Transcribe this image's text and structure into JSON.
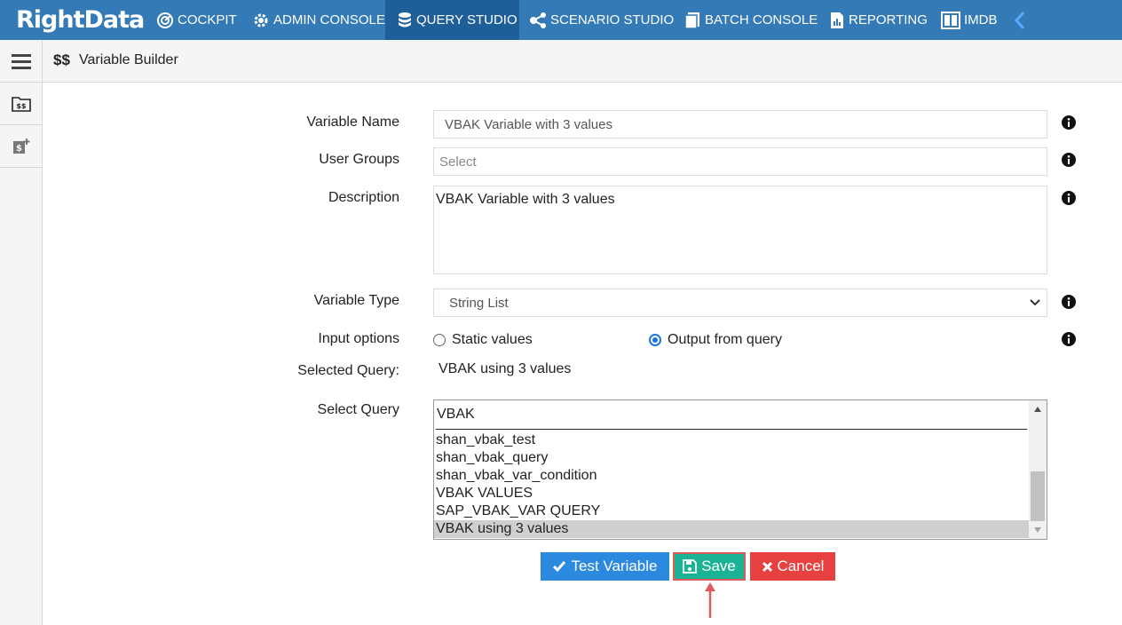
{
  "app": {
    "logo": "RightData"
  },
  "nav": [
    {
      "label": "COCKPIT",
      "icon": "cockpit-icon"
    },
    {
      "label": "ADMIN CONSOLE",
      "icon": "gear-icon"
    },
    {
      "label": "QUERY STUDIO",
      "icon": "database-icon",
      "active": true
    },
    {
      "label": "SCENARIO STUDIO",
      "icon": "network-icon"
    },
    {
      "label": "BATCH CONSOLE",
      "icon": "batch-icon"
    },
    {
      "label": "REPORTING",
      "icon": "report-icon"
    },
    {
      "label": "IMDB",
      "icon": "columns-icon"
    }
  ],
  "header": {
    "icon_text": "$$",
    "title": "Variable Builder"
  },
  "form": {
    "variable_name_label": "Variable Name",
    "variable_name_value": "VBAK Variable with 3 values",
    "user_groups_label": "User Groups",
    "user_groups_placeholder": "Select",
    "description_label": "Description",
    "description_value": "VBAK Variable with 3 values",
    "variable_type_label": "Variable Type",
    "variable_type_value": "String List",
    "input_options_label": "Input options",
    "input_options": [
      {
        "label": "Static values",
        "checked": false
      },
      {
        "label": "Output from query",
        "checked": true
      }
    ],
    "selected_query_label": "Selected Query:",
    "selected_query_value": "VBAK using 3 values",
    "select_query_label": "Select Query",
    "select_query_search": "VBAK",
    "query_options": [
      "shan_vbak_test",
      "shan_vbak_query",
      "shan_vbak_var_condition",
      "VBAK VALUES",
      "SAP_VBAK_VAR QUERY",
      "VBAK using 3 values"
    ],
    "selected_option_index": 5
  },
  "buttons": {
    "test_label": "Test Variable",
    "save_label": "Save",
    "cancel_label": "Cancel"
  },
  "colors": {
    "nav_bg": "#337ab7",
    "test_btn": "#2b8ae0",
    "save_btn": "#1ab394",
    "cancel_btn": "#e74040",
    "highlight": "#e05a5a"
  }
}
